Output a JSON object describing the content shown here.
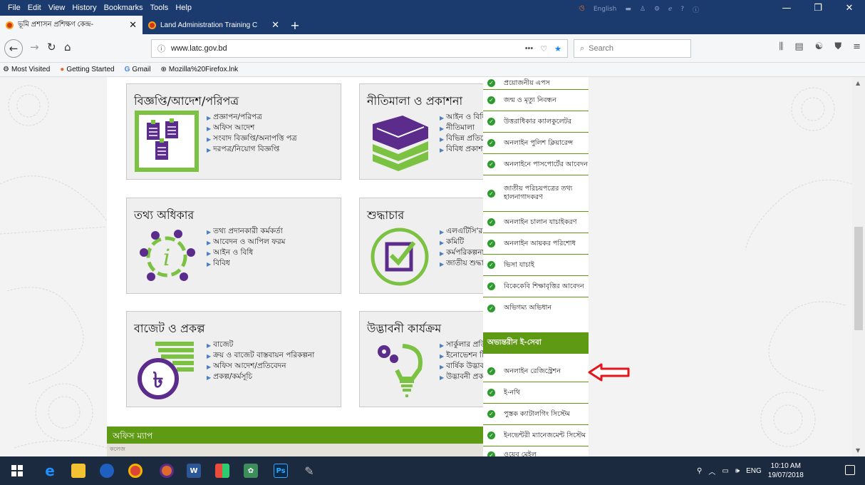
{
  "menubar": {
    "items": [
      "File",
      "Edit",
      "View",
      "History",
      "Bookmarks",
      "Tools",
      "Help"
    ],
    "lang": "English"
  },
  "tabs": [
    {
      "title": "ভূমি প্রশাসন প্রশিক্ষণ কেন্দ্র-",
      "active": true
    },
    {
      "title": "Land Administration Training C",
      "active": false
    }
  ],
  "navbar": {
    "url": "www.latc.gov.bd",
    "search_placeholder": "Search"
  },
  "bookmarks": [
    "Most Visited",
    "Getting Started",
    "Gmail",
    "Mozilla%20Firefox.lnk"
  ],
  "cards": [
    {
      "title": "বিজ্ঞপ্তি/আদেশ/পরিপত্র",
      "links": [
        "প্রজ্ঞাপন/পরিপত্র",
        "অফিস আদেশ",
        "সংবাদ বিজ্ঞপ্তি/অনাপত্তি পত্র",
        "দরপত্র/নিয়োগ বিজ্ঞপ্তি"
      ]
    },
    {
      "title": "নীতিমালা ও প্রকাশনা",
      "links": [
        "আইন ও বিধি",
        "নীতিমালা",
        "বিভিন্ন প্রতিবেদন",
        "বিবিধ প্রকাশনা"
      ]
    },
    {
      "title": "তথ্য অধিকার",
      "links": [
        "তথ্য প্রদানকারী কর্মকর্তা",
        "আবেদন ও আপিল ফরম",
        "আইন ও বিধি",
        "বিবিধ"
      ]
    },
    {
      "title": "শুদ্ধাচার",
      "links": [
        "এলএটিসি'র কার্যক্রম",
        "কমিটি",
        "কর্মপরিকল্পনা",
        "জাতীয় শুদ্ধাচার ফোকাল পয়েন্ট"
      ]
    },
    {
      "title": "বাজেট ও প্রকল্প",
      "links": [
        "বাজেট",
        "ক্রয় ও বাজেট বাস্তবায়ন পরিকল্পনা",
        "অফিস আদেশ/প্রতিবেদন",
        "প্রকল্প/কর্মসূচি"
      ]
    },
    {
      "title": "উদ্ভাবনী কার্যক্রম",
      "links": [
        "সার্কুলার প্রতিবেদন",
        "ইনোভেশন টিম",
        "বার্ষিক উদ্ভাবন কর্মপরিকল্পনা",
        "উদ্ভাবনী প্রকল্পসমূহ"
      ]
    }
  ],
  "map": {
    "title": "অফিস ম্যাপ",
    "strip_text": "কলেজ"
  },
  "sidebar": {
    "eservices": [
      "প্রয়োজনীয় এপস",
      "জন্ম ও মৃত্যু নিবন্ধন",
      "উত্তরাধিকার ক্যালকুলেটর",
      "অনলাইন পুলিশ ক্লিয়ারেন্স",
      "অনলাইনে পাসপোর্টের আবেদন",
      "জাতীয় পরিচয়পত্রের তথ্য হালনাগাদকরণ",
      "অনলাইন চালান যাচাইকরণ",
      "অনলাইন আয়কর পরিশোধ",
      "ভিসা যাচাই",
      "বিকেকেবি শিক্ষাবৃত্তির আবেদন",
      "অভিগম্য অভিধান"
    ],
    "internal_heading": "অভ্যন্তরীন ই-সেবা",
    "internal": [
      "অনলাইন রেজিস্ট্রেশন",
      "ই-নথি",
      "পুস্তক ক্যাটালগিং সিস্টেম",
      "ইনভেন্টরী ম্যানেজমেন্ট সিস্টেম",
      "ওয়েব মেইল"
    ]
  },
  "taskbar": {
    "lang": "ENG",
    "time": "10:10 AM",
    "date": "19/07/2018"
  },
  "colors": {
    "brand_green": "#5e9a14",
    "icon_purple": "#5c2c8c",
    "firefox_blue": "#1b3a6e",
    "callout_red": "#e3161b"
  }
}
